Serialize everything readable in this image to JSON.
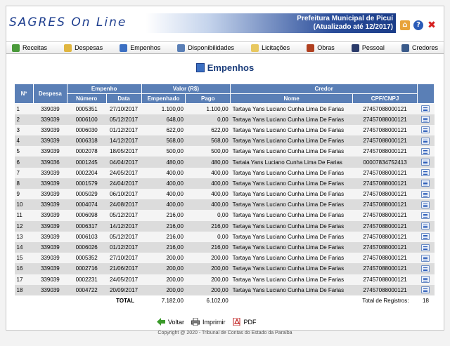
{
  "header": {
    "logo": "SAGRES On Line",
    "pref_line1": "Prefeitura Municipal de Picuí",
    "pref_line2": "(Atualizado até 12/2017)"
  },
  "nav": [
    {
      "label": "Receitas",
      "color": "#4a9a3a"
    },
    {
      "label": "Despesas",
      "color": "#e0b640"
    },
    {
      "label": "Empenhos",
      "color": "#3b6fc2"
    },
    {
      "label": "Disponibilidades",
      "color": "#5a7fb6"
    },
    {
      "label": "Licitações",
      "color": "#e8c860"
    },
    {
      "label": "Obras",
      "color": "#b04020"
    },
    {
      "label": "Pessoal",
      "color": "#2a3a6a"
    },
    {
      "label": "Credores",
      "color": "#3a5a8a"
    }
  ],
  "title": "Empenhos",
  "table": {
    "group_headers": {
      "empenho": "Empenho",
      "valor": "Valor (R$)",
      "credor": "Credor"
    },
    "headers": {
      "n": "Nº",
      "despesa": "Despesa",
      "numero": "Número",
      "data": "Data",
      "empenhado": "Empenhado",
      "pago": "Pago",
      "nome": "Nome",
      "cpf": "CPF/CNPJ"
    },
    "rows": [
      {
        "n": "1",
        "despesa": "339039",
        "numero": "0005351",
        "data": "27/10/2017",
        "empenhado": "1.100,00",
        "pago": "1.100,00",
        "nome": "Tartaya Yans Luciano Cunha Lima De Farias",
        "cpf": "27457088000121"
      },
      {
        "n": "2",
        "despesa": "339039",
        "numero": "0006100",
        "data": "05/12/2017",
        "empenhado": "648,00",
        "pago": "0,00",
        "nome": "Tartaya Yans Luciano Cunha Lima De Farias",
        "cpf": "27457088000121"
      },
      {
        "n": "3",
        "despesa": "339039",
        "numero": "0006030",
        "data": "01/12/2017",
        "empenhado": "622,00",
        "pago": "622,00",
        "nome": "Tartaya Yans Luciano Cunha Lima De Farias",
        "cpf": "27457088000121"
      },
      {
        "n": "4",
        "despesa": "339039",
        "numero": "0006318",
        "data": "14/12/2017",
        "empenhado": "568,00",
        "pago": "568,00",
        "nome": "Tartaya Yans Luciano Cunha Lima De Farias",
        "cpf": "27457088000121"
      },
      {
        "n": "5",
        "despesa": "339039",
        "numero": "0002078",
        "data": "18/05/2017",
        "empenhado": "500,00",
        "pago": "500,00",
        "nome": "Tartaya Yans Luciano Cunha Lima De Farias",
        "cpf": "27457088000121"
      },
      {
        "n": "6",
        "despesa": "339036",
        "numero": "0001245",
        "data": "04/04/2017",
        "empenhado": "480,00",
        "pago": "480,00",
        "nome": "Tartaia Yans Luciano Cunha Lima De Farias",
        "cpf": "00007834752413"
      },
      {
        "n": "7",
        "despesa": "339039",
        "numero": "0002204",
        "data": "24/05/2017",
        "empenhado": "400,00",
        "pago": "400,00",
        "nome": "Tartaya Yans Luciano Cunha Lima De Farias",
        "cpf": "27457088000121"
      },
      {
        "n": "8",
        "despesa": "339039",
        "numero": "0001579",
        "data": "24/04/2017",
        "empenhado": "400,00",
        "pago": "400,00",
        "nome": "Tartaya Yans Luciano Cunha Lima De Farias",
        "cpf": "27457088000121"
      },
      {
        "n": "9",
        "despesa": "339039",
        "numero": "0005029",
        "data": "06/10/2017",
        "empenhado": "400,00",
        "pago": "400,00",
        "nome": "Tartaya Yans Luciano Cunha Lima De Farias",
        "cpf": "27457088000121"
      },
      {
        "n": "10",
        "despesa": "339039",
        "numero": "0004074",
        "data": "24/08/2017",
        "empenhado": "400,00",
        "pago": "400,00",
        "nome": "Tartaya Yans Luciano Cunha Lima De Farias",
        "cpf": "27457088000121"
      },
      {
        "n": "11",
        "despesa": "339039",
        "numero": "0006098",
        "data": "05/12/2017",
        "empenhado": "216,00",
        "pago": "0,00",
        "nome": "Tartaya Yans Luciano Cunha Lima De Farias",
        "cpf": "27457088000121"
      },
      {
        "n": "12",
        "despesa": "339039",
        "numero": "0006317",
        "data": "14/12/2017",
        "empenhado": "216,00",
        "pago": "216,00",
        "nome": "Tartaya Yans Luciano Cunha Lima De Farias",
        "cpf": "27457088000121"
      },
      {
        "n": "13",
        "despesa": "339039",
        "numero": "0006103",
        "data": "05/12/2017",
        "empenhado": "216,00",
        "pago": "0,00",
        "nome": "Tartaya Yans Luciano Cunha Lima De Farias",
        "cpf": "27457088000121"
      },
      {
        "n": "14",
        "despesa": "339039",
        "numero": "0006026",
        "data": "01/12/2017",
        "empenhado": "216,00",
        "pago": "216,00",
        "nome": "Tartaya Yans Luciano Cunha Lima De Farias",
        "cpf": "27457088000121"
      },
      {
        "n": "15",
        "despesa": "339039",
        "numero": "0005352",
        "data": "27/10/2017",
        "empenhado": "200,00",
        "pago": "200,00",
        "nome": "Tartaya Yans Luciano Cunha Lima De Farias",
        "cpf": "27457088000121"
      },
      {
        "n": "16",
        "despesa": "339039",
        "numero": "0002716",
        "data": "21/06/2017",
        "empenhado": "200,00",
        "pago": "200,00",
        "nome": "Tartaya Yans Luciano Cunha Lima De Farias",
        "cpf": "27457088000121"
      },
      {
        "n": "17",
        "despesa": "339039",
        "numero": "0002231",
        "data": "24/05/2017",
        "empenhado": "200,00",
        "pago": "200,00",
        "nome": "Tartaya Yans Luciano Cunha Lima De Farias",
        "cpf": "27457088000121"
      },
      {
        "n": "18",
        "despesa": "339039",
        "numero": "0004722",
        "data": "20/09/2017",
        "empenhado": "200,00",
        "pago": "200,00",
        "nome": "Tartaya Yans Luciano Cunha Lima De Farias",
        "cpf": "27457088000121"
      }
    ],
    "totals": {
      "label": "TOTAL",
      "empenhado": "7.182,00",
      "pago": "6.102,00",
      "records_label": "Total de Registros:",
      "records": "18"
    }
  },
  "footer": {
    "voltar": "Voltar",
    "imprimir": "Imprimir",
    "pdf": "PDF",
    "copyright": "Copyright @ 2020 - Tribunal de Contas do Estado da Paraíba"
  }
}
